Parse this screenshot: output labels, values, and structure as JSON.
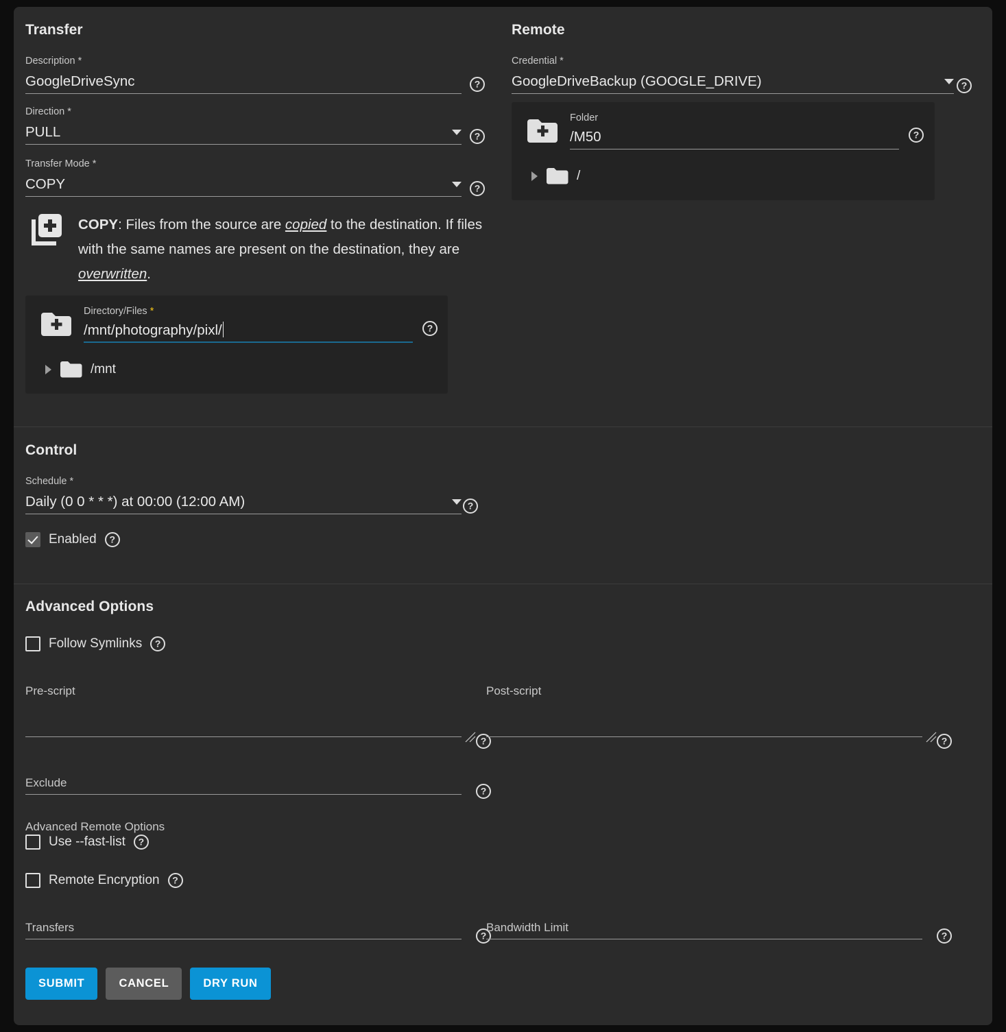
{
  "transfer": {
    "title": "Transfer",
    "description": {
      "label": "Description",
      "required": "*",
      "value": "GoogleDriveSync"
    },
    "direction": {
      "label": "Direction",
      "required": "*",
      "value": "PULL"
    },
    "transfer_mode": {
      "label": "Transfer Mode",
      "required": "*",
      "value": "COPY"
    },
    "mode_info": {
      "keyword": "COPY",
      "part1": ": Files from the source are ",
      "em1": "copied",
      "part2": " to the destination. If files with the same names are present on the destination, they are ",
      "em2": "overwritten",
      "part3": "."
    },
    "directory": {
      "label": "Directory/Files",
      "required": "*",
      "value": "/mnt/photography/pixl/",
      "tree_root": "/mnt"
    }
  },
  "remote": {
    "title": "Remote",
    "credential": {
      "label": "Credential",
      "required": "*",
      "value": "GoogleDriveBackup (GOOGLE_DRIVE)"
    },
    "folder": {
      "label": "Folder",
      "value": "/M50",
      "tree_root": "/"
    }
  },
  "control": {
    "title": "Control",
    "schedule": {
      "label": "Schedule",
      "required": "*",
      "value": "Daily (0 0 * * *) at 00:00 (12:00 AM)"
    },
    "enabled": {
      "label": "Enabled",
      "checked": true
    }
  },
  "advanced": {
    "title": "Advanced Options",
    "follow_symlinks": {
      "label": "Follow Symlinks",
      "checked": false
    },
    "pre_script": {
      "label": "Pre-script",
      "value": ""
    },
    "post_script": {
      "label": "Post-script",
      "value": ""
    },
    "exclude": {
      "label": "Exclude",
      "value": ""
    },
    "remote_options_title": "Advanced Remote Options",
    "fast_list": {
      "label": "Use --fast-list",
      "checked": false
    },
    "remote_encryption": {
      "label": "Remote Encryption",
      "checked": false
    },
    "transfers": {
      "label": "Transfers",
      "value": ""
    },
    "bandwidth_limit": {
      "label": "Bandwidth Limit",
      "value": ""
    }
  },
  "actions": {
    "submit": "SUBMIT",
    "cancel": "CANCEL",
    "dry_run": "DRY RUN"
  },
  "icons": {
    "help": "?",
    "copy_plus": "library-add-icon",
    "folder_plus": "folder-add-icon",
    "folder": "folder-icon"
  },
  "colors": {
    "accent": "#0b93d5",
    "secondary_button": "#5c5c5c",
    "card_bg": "#2b2b2b",
    "panel_bg": "#232323",
    "focus_underline": "#1a6a91",
    "required_gold": "#f5c518"
  }
}
